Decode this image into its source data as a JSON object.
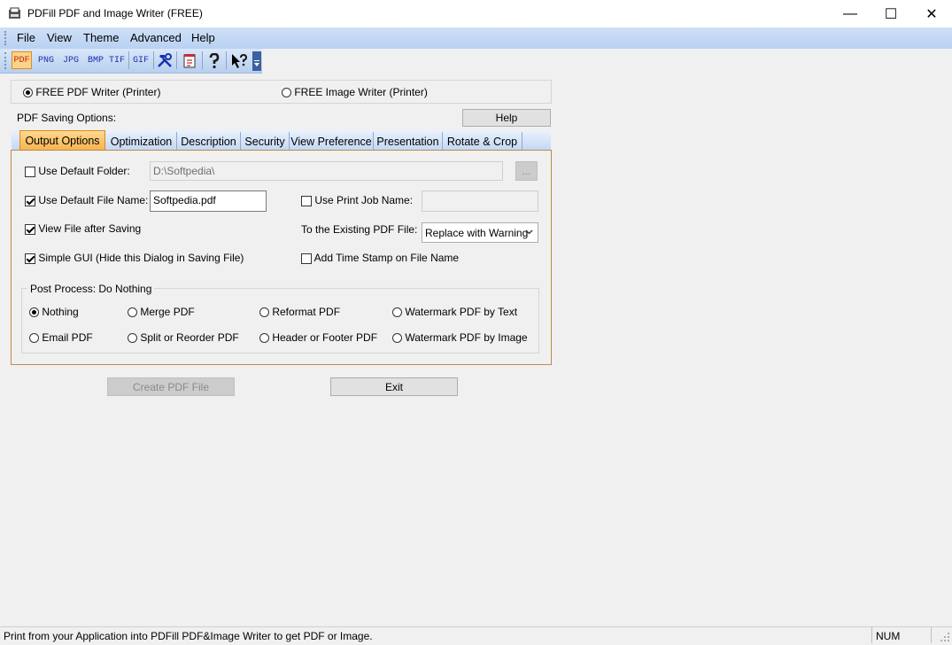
{
  "window": {
    "title": "PDFill PDF and Image Writer (FREE)",
    "minimize": "—",
    "maximize": "☐",
    "close": "✕"
  },
  "menu": [
    "File",
    "View",
    "Theme",
    "Advanced",
    "Help"
  ],
  "toolbar": {
    "buttons": [
      "PDF",
      "PNG",
      "JPG",
      "BMP",
      "TIF",
      "GIF"
    ],
    "icons": [
      "tools-icon",
      "document-icon",
      "help-icon",
      "whats-this-icon",
      "toolbar-options-icon"
    ]
  },
  "writer_select": {
    "pdf_writer": "FREE PDF Writer (Printer)",
    "image_writer": "FREE Image Writer (Printer)",
    "selected": "pdf_writer"
  },
  "pdf_saving_label": "PDF Saving Options:",
  "help_button": "Help",
  "tabs": [
    "Output Options",
    "Optimization",
    "Description",
    "Security",
    "View Preference",
    "Presentation",
    "Rotate & Crop"
  ],
  "active_tab": "Output Options",
  "output_options": {
    "use_default_folder": {
      "label": "Use Default Folder:",
      "checked": false,
      "value": "D:\\Softpedia\\"
    },
    "browse_button": "...",
    "use_default_file_name": {
      "label": "Use Default File Name:",
      "checked": true,
      "value": "Softpedia.pdf"
    },
    "use_print_job_name": {
      "label": "Use Print Job Name:",
      "checked": false,
      "value": ""
    },
    "view_file_after_saving": {
      "label": "View File after Saving",
      "checked": true
    },
    "existing_pdf_label": "To the Existing PDF File:",
    "existing_pdf_value": "Replace with Warning",
    "simple_gui": {
      "label": "Simple GUI (Hide this Dialog in Saving File)",
      "checked": true
    },
    "add_time_stamp": {
      "label": "Add Time Stamp on File Name",
      "checked": false
    },
    "post_process": {
      "title": "Post Process: Do Nothing",
      "options": [
        "Nothing",
        "Merge PDF",
        "Reformat PDF",
        "Watermark PDF by Text",
        "Email PDF",
        "Split or Reorder PDF",
        "Header or Footer PDF",
        "Watermark PDF by Image"
      ],
      "selected": "Nothing"
    }
  },
  "create_pdf_button": "Create PDF File",
  "exit_button": "Exit",
  "status": {
    "message": "Print from your Application into PDFill PDF&Image Writer to get PDF or Image.",
    "num": "NUM"
  },
  "colors": {
    "menubar": "#b9d1f2",
    "active_tab": "#f6b24d",
    "panel_border": "#c08a45"
  }
}
